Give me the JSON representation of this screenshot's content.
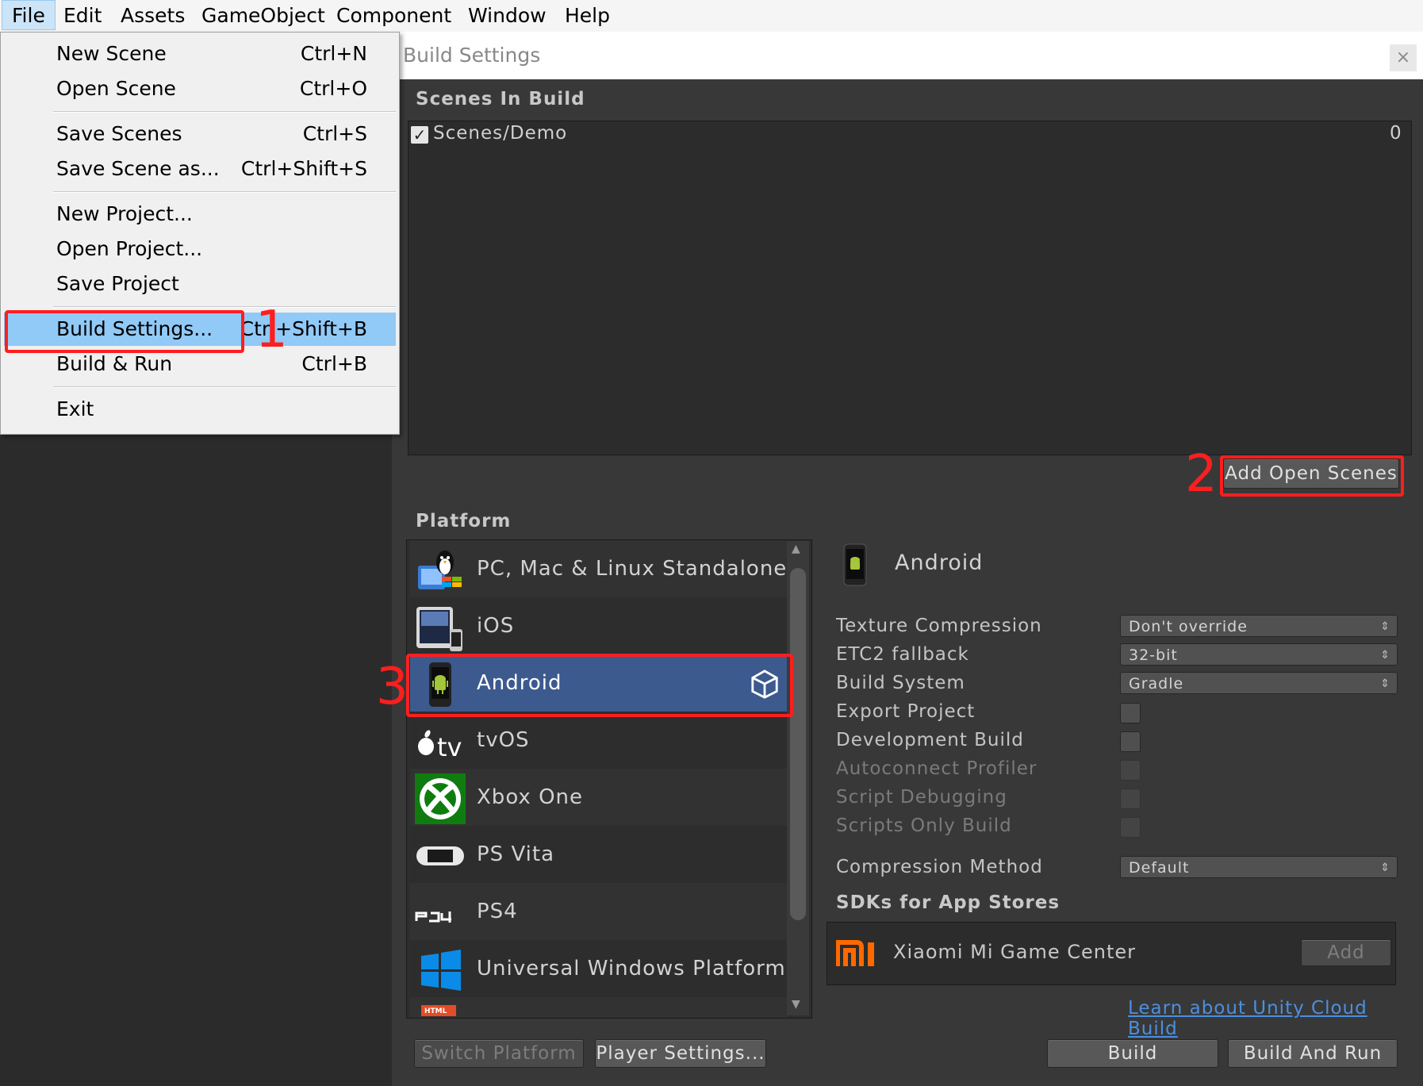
{
  "menubar": {
    "items": [
      "File",
      "Edit",
      "Assets",
      "GameObject",
      "Component",
      "Window",
      "Help"
    ]
  },
  "file_menu": {
    "items": [
      {
        "label": "New Scene",
        "shortcut": "Ctrl+N"
      },
      {
        "label": "Open Scene",
        "shortcut": "Ctrl+O"
      },
      {
        "label": "Save Scenes",
        "shortcut": "Ctrl+S"
      },
      {
        "label": "Save Scene as...",
        "shortcut": "Ctrl+Shift+S"
      },
      {
        "label": "New Project...",
        "shortcut": ""
      },
      {
        "label": "Open Project...",
        "shortcut": ""
      },
      {
        "label": "Save Project",
        "shortcut": ""
      },
      {
        "label": "Build Settings...",
        "shortcut": "Ctrl+Shift+B"
      },
      {
        "label": "Build & Run",
        "shortcut": "Ctrl+B"
      },
      {
        "label": "Exit",
        "shortcut": ""
      }
    ],
    "highlighted_index": 7
  },
  "annotations": {
    "step1": "1",
    "step2": "2",
    "step3": "3",
    "color": "#ff1e1e"
  },
  "build_window": {
    "title": "Build Settings",
    "close_glyph": "×",
    "scenes_title": "Scenes In Build",
    "scenes": [
      {
        "name": "Scenes/Demo",
        "checked": true,
        "index": "0"
      }
    ],
    "add_open_scenes": "Add Open Scenes",
    "platform_title": "Platform",
    "platforms": [
      {
        "name": "PC, Mac & Linux Standalone",
        "icon": "pc-mac-linux-icon"
      },
      {
        "name": "iOS",
        "icon": "ios-devices-icon"
      },
      {
        "name": "Android",
        "icon": "android-phone-icon",
        "selected": true,
        "current": true
      },
      {
        "name": "tvOS",
        "icon": "apple-tv-icon"
      },
      {
        "name": "Xbox One",
        "icon": "xbox-icon"
      },
      {
        "name": "PS Vita",
        "icon": "ps-vita-icon"
      },
      {
        "name": "PS4",
        "icon": "ps4-icon"
      },
      {
        "name": "Universal Windows Platform",
        "icon": "windows-icon"
      }
    ],
    "partial_next_icon_text": "HTML",
    "selected_platform": "Android",
    "settings": [
      {
        "label": "Texture Compression",
        "type": "dropdown",
        "value": "Don't override"
      },
      {
        "label": "ETC2 fallback",
        "type": "dropdown",
        "value": "32-bit"
      },
      {
        "label": "Build System",
        "type": "dropdown",
        "value": "Gradle"
      },
      {
        "label": "Export Project",
        "type": "checkbox",
        "checked": false
      },
      {
        "label": "Development Build",
        "type": "checkbox",
        "checked": false
      },
      {
        "label": "Autoconnect Profiler",
        "type": "checkbox",
        "checked": false,
        "disabled": true
      },
      {
        "label": "Script Debugging",
        "type": "checkbox",
        "checked": false,
        "disabled": true
      },
      {
        "label": "Scripts Only Build",
        "type": "checkbox",
        "checked": false,
        "disabled": true
      },
      {
        "label": "Compression Method",
        "type": "dropdown",
        "value": "Default"
      }
    ],
    "sdk_title": "SDKs for App Stores",
    "sdk_item": {
      "name": "Xiaomi Mi Game Center",
      "button": "Add"
    },
    "cloud_link": "Learn about Unity Cloud Build",
    "buttons": {
      "switch_platform": "Switch Platform",
      "player_settings": "Player Settings...",
      "build": "Build",
      "build_and_run": "Build And Run"
    }
  },
  "colors": {
    "selection_blue": "#3c5a8e",
    "menu_highlight": "#91c9f7",
    "link_blue": "#4c8fe0",
    "xbox_green": "#107c10",
    "mi_orange": "#ff6900"
  }
}
